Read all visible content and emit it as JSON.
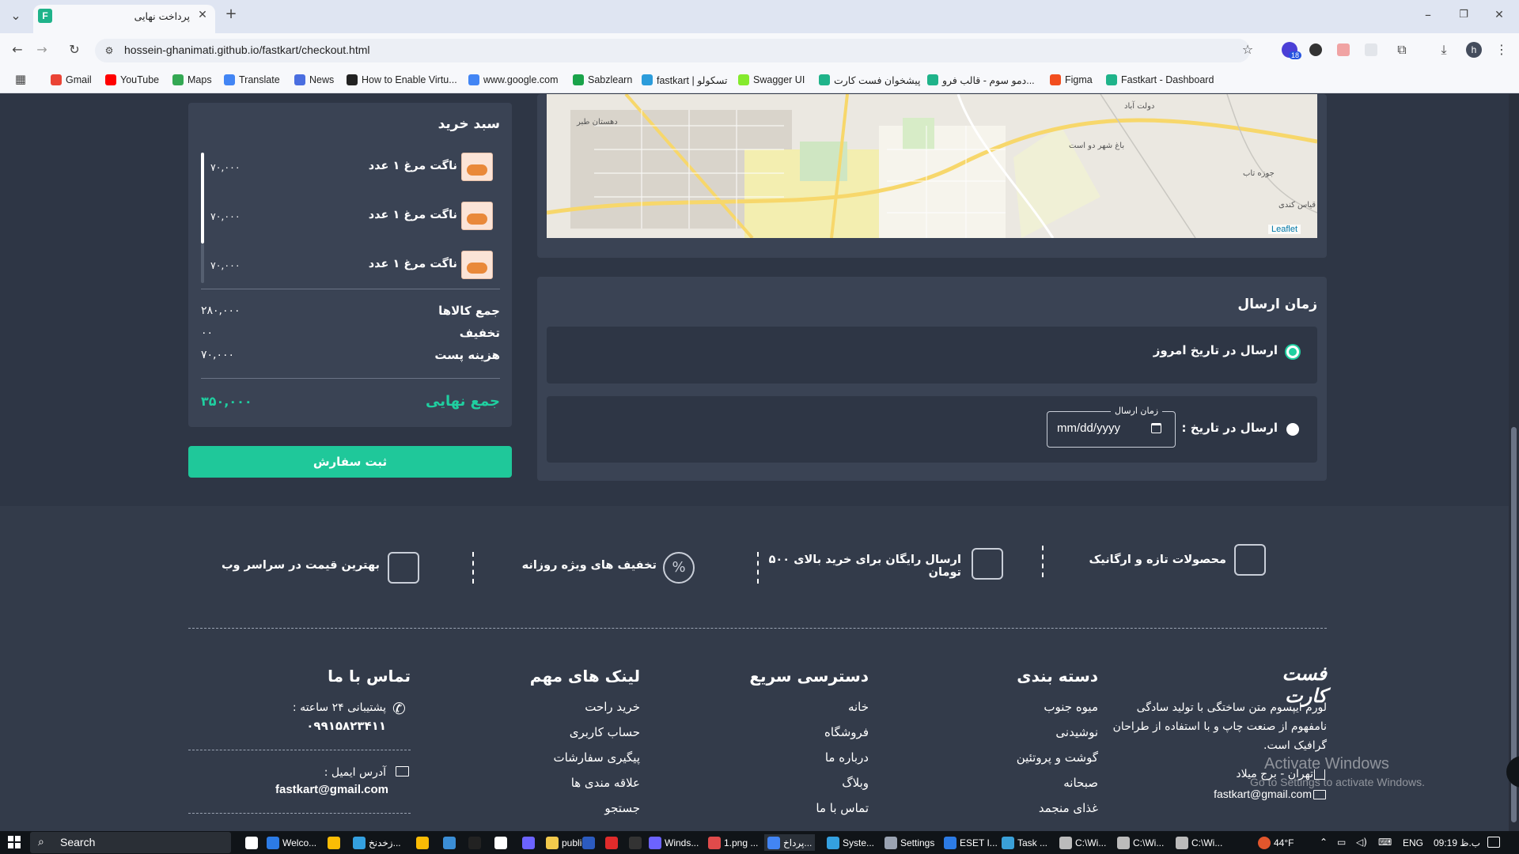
{
  "browser": {
    "tab_title": "پرداخت نهایی",
    "tab_icon": "F",
    "url": "hossein-ghanimati.github.io/fastkart/checkout.html",
    "profile_initial": "h",
    "extension_badge": "18"
  },
  "bookmarks": [
    {
      "label": "Gmail",
      "color": "#ea4335"
    },
    {
      "label": "YouTube",
      "color": "#ff0000"
    },
    {
      "label": "Maps",
      "color": "#34a853"
    },
    {
      "label": "Translate",
      "color": "#4285f4"
    },
    {
      "label": "News",
      "color": "#4a6ee0"
    },
    {
      "label": "How to Enable Virtu...",
      "color": "#222222"
    },
    {
      "label": "www.google.com",
      "color": "#4285f4"
    },
    {
      "label": "Sabzlearn",
      "color": "#1aa34a"
    },
    {
      "label": "fastkart | تسکولو",
      "color": "#2c9cdb"
    },
    {
      "label": "Swagger UI",
      "color": "#85ea2d"
    },
    {
      "label": "پیشخوان فست کارت",
      "color": "#1fb38a"
    },
    {
      "label": "دمو سوم - قالب فرو...",
      "color": "#1fb38a"
    },
    {
      "label": "Figma",
      "color": "#f24e1e"
    },
    {
      "label": "Fastkart - Dashboard",
      "color": "#1fb38a"
    }
  ],
  "map": {
    "attribution": "Leaflet",
    "labels": [
      "دولت آباد",
      "باغ شهر دو است",
      "جوزه تاب",
      "قیاس کندی",
      "دهستان طبر"
    ]
  },
  "cart": {
    "title": "سبد خرید",
    "items": [
      {
        "name": "ناگت مرغ ۱ عدد",
        "price": "۷۰,۰۰۰"
      },
      {
        "name": "ناگت مرغ ۱ عدد",
        "price": "۷۰,۰۰۰"
      },
      {
        "name": "ناگت مرغ ۱ عدد",
        "price": "۷۰,۰۰۰"
      }
    ],
    "subtotal_label": "جمع کالاها",
    "subtotal": "۲۸۰,۰۰۰",
    "discount_label": "تخفیف",
    "discount": "۰۰",
    "shipping_label": "هزینه پست",
    "shipping": "۷۰,۰۰۰",
    "total_label": "جمع نهایی",
    "total": "۳۵۰,۰۰۰",
    "submit_label": "ثبت سفارش"
  },
  "delivery": {
    "title": "زمان ارسال",
    "option_today": "ارسال در تاریخ امروز",
    "option_date": "ارسال در تاریخ :",
    "date_legend": "زمان ارسال",
    "date_placeholder": "mm/dd/yyyy"
  },
  "features": [
    {
      "label": "محصولات تازه و ارگانیک",
      "icon": "grocery-bag-icon"
    },
    {
      "label": "ارسال رایگان برای خرید بالای ۵۰۰ تومان",
      "icon": "delivery-truck-icon"
    },
    {
      "label": "تخفیف های ویژه روزانه",
      "icon": "discount-badge-icon"
    },
    {
      "label": "بهترین قیمت در سراسر وب",
      "icon": "thumbs-up-icon"
    }
  ],
  "footer": {
    "logo": "فست کارت",
    "about": "لورم ایپسوم متن ساختگی با تولید سادگی نامفهوم از صنعت چاپ و با استفاده از طراحان گرافیک است.",
    "address": "تهران - برج میلاد",
    "email": "fastkart@gmail.com",
    "categories_title": "دسته بندی",
    "categories": [
      "میوه جنوب",
      "نوشیدنی",
      "گوشت و پروتئین",
      "صبحانه",
      "غذای منجمد"
    ],
    "quick_title": "دسترسی سریع",
    "quick": [
      "خانه",
      "فروشگاه",
      "درباره ما",
      "وبلاگ",
      "تماس با ما"
    ],
    "links_title": "لینک های مهم",
    "links": [
      "خرید راحت",
      "حساب کاربری",
      "پیگیری سفارشات",
      "علاقه مندی ها",
      "جستجو"
    ],
    "contact_title": "تماس با ما",
    "support_label": "پشتیبانی ۲۴ ساعته :",
    "support_phone": "۰۹۹۱۵۸۲۳۴۱۱",
    "email_label": "آدرس ایمیل :",
    "contact_email": "fastkart@gmail.com"
  },
  "watermark": {
    "title": "Activate Windows",
    "subtitle": "Go to Settings to activate Windows."
  },
  "taskbar": {
    "search": "Search",
    "apps": [
      "Welco...",
      "زخدنخ...",
      "public",
      "Winds...",
      "1.png ...",
      "پرداخ...",
      "Syste...",
      "Settings",
      "ESET I...",
      "Task ...",
      "C:\\Wi...",
      "C:\\Wi...",
      "C:\\Wi..."
    ],
    "weather": "44°F",
    "lang": "ENG",
    "time": "09:19 ب.ظ"
  }
}
